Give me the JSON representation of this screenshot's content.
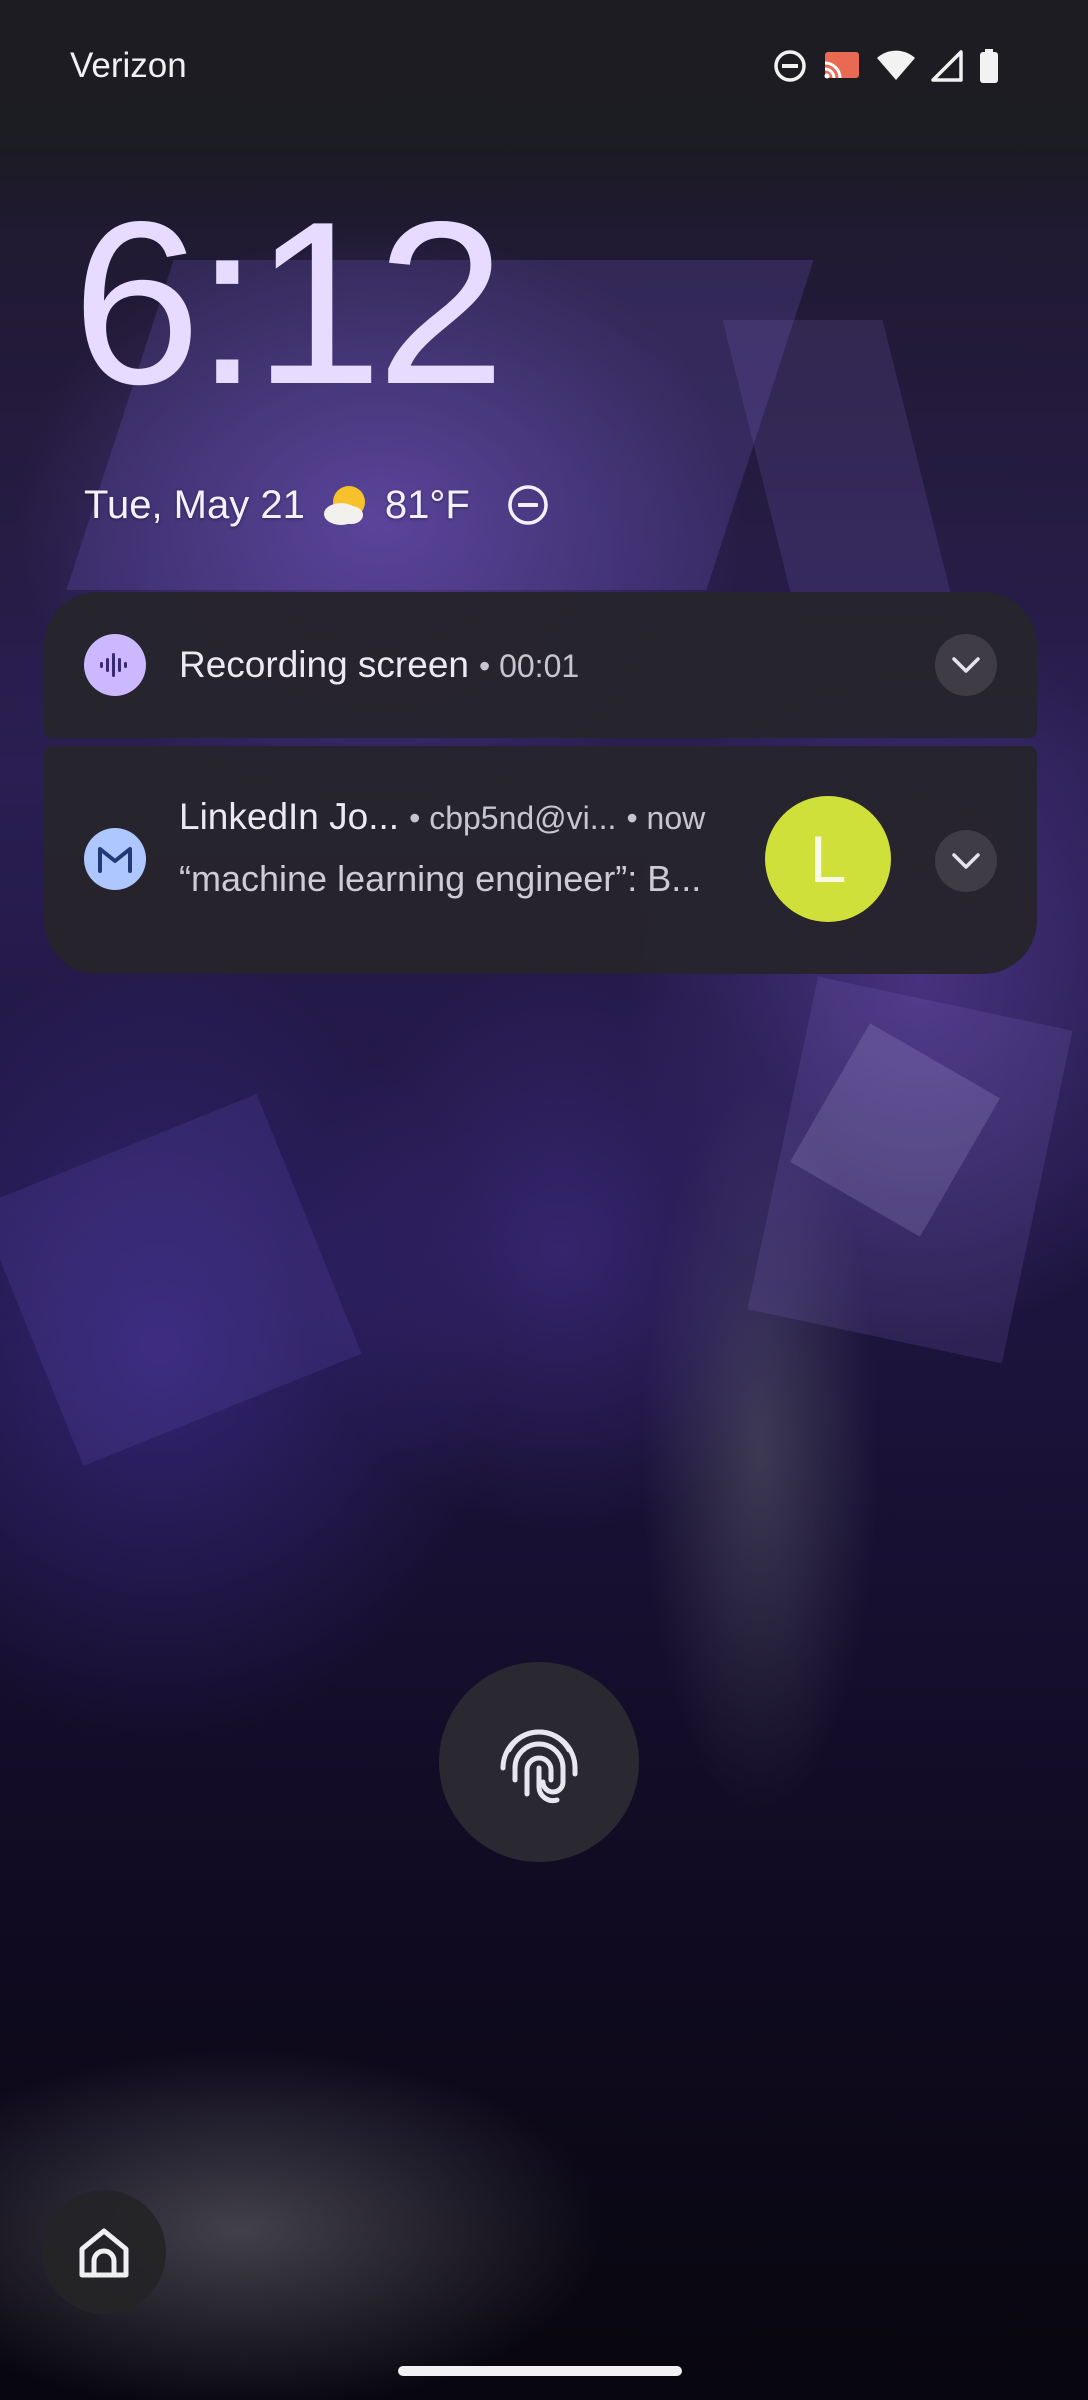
{
  "status_bar": {
    "carrier": "Verizon",
    "icons": [
      "do-not-disturb-icon",
      "cast-icon",
      "wifi-icon",
      "cell-signal-icon",
      "battery-icon"
    ]
  },
  "lockscreen": {
    "time": "6:12",
    "date": "Tue, May 21",
    "weather_icon": "partly-cloudy-icon",
    "temperature": "81°F",
    "dnd_icon": "do-not-disturb-icon"
  },
  "notifications": [
    {
      "app_icon": "sound-wave-icon",
      "title": "Recording screen",
      "meta": "• 00:01",
      "accent": "#cbb8ff"
    },
    {
      "app_icon": "gmail-icon",
      "title": "LinkedIn Jo...",
      "account": "• cbp5nd@vi...",
      "time": "• now",
      "body": "“machine learning engineer”: B...",
      "avatar_letter": "L",
      "avatar_color": "#cfe03a",
      "accent": "#aec8ff"
    }
  ],
  "bottom": {
    "fingerprint_icon": "fingerprint-icon",
    "home_shortcut_icon": "home-icon"
  },
  "colors": {
    "clock": "#e7dcff",
    "notification_bg": "#26242c"
  }
}
